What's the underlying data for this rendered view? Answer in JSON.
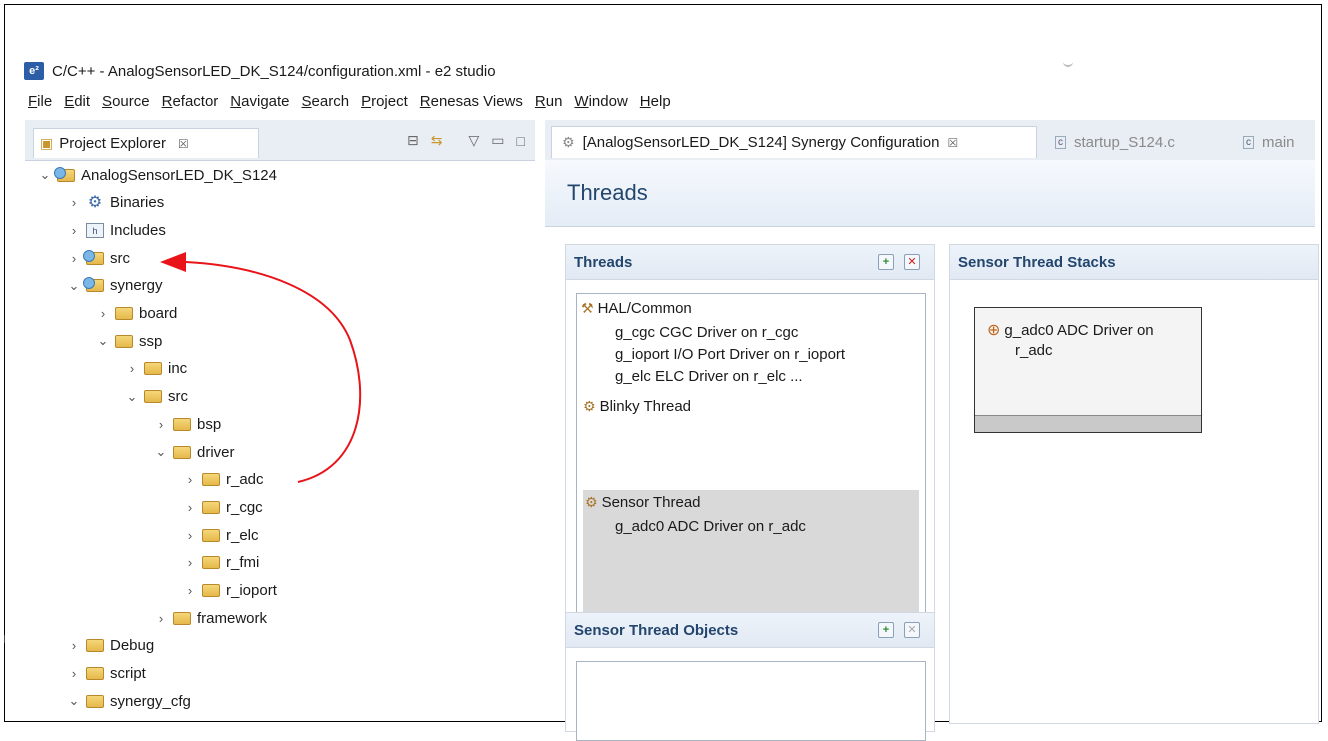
{
  "window": {
    "title": "C/C++ - AnalogSensorLED_DK_S124/configuration.xml - e2 studio",
    "logo_text": "e²"
  },
  "menu": [
    "File",
    "Edit",
    "Source",
    "Refactor",
    "Navigate",
    "Search",
    "Project",
    "Renesas Views",
    "Run",
    "Window",
    "Help"
  ],
  "project_explorer": {
    "tab_label": "Project Explorer",
    "tab_close": "☒",
    "tree": [
      {
        "label": "AnalogSensorLED_DK_S124",
        "chevron": "⌄",
        "icon": "project-icon"
      },
      {
        "label": "Binaries",
        "chevron": "›",
        "icon": "binaries-icon"
      },
      {
        "label": "Includes",
        "chevron": "›",
        "icon": "includes-icon"
      },
      {
        "label": "src",
        "chevron": "›",
        "icon": "source-folder-icon"
      },
      {
        "label": "synergy",
        "chevron": "⌄",
        "icon": "source-folder-icon"
      },
      {
        "label": "board",
        "chevron": "›",
        "icon": "folder-icon"
      },
      {
        "label": "ssp",
        "chevron": "⌄",
        "icon": "folder-icon"
      },
      {
        "label": "inc",
        "chevron": "›",
        "icon": "folder-icon"
      },
      {
        "label": "src",
        "chevron": "⌄",
        "icon": "folder-icon"
      },
      {
        "label": "bsp",
        "chevron": "›",
        "icon": "folder-icon"
      },
      {
        "label": "driver",
        "chevron": "⌄",
        "icon": "folder-icon"
      },
      {
        "label": "r_adc",
        "chevron": "›",
        "icon": "folder-icon"
      },
      {
        "label": "r_cgc",
        "chevron": "›",
        "icon": "folder-icon"
      },
      {
        "label": "r_elc",
        "chevron": "›",
        "icon": "folder-icon"
      },
      {
        "label": "r_fmi",
        "chevron": "›",
        "icon": "folder-icon"
      },
      {
        "label": "r_ioport",
        "chevron": "›",
        "icon": "folder-icon"
      },
      {
        "label": "framework",
        "chevron": "›",
        "icon": "folder-icon"
      },
      {
        "label": "Debug",
        "chevron": "›",
        "icon": "folder-icon"
      },
      {
        "label": "script",
        "chevron": "›",
        "icon": "folder-icon"
      },
      {
        "label": "synergy_cfg",
        "chevron": "⌄",
        "icon": "folder-icon"
      }
    ]
  },
  "editor": {
    "tabs": [
      {
        "label": "[AnalogSensorLED_DK_S124] Synergy Configuration",
        "close": "☒"
      },
      {
        "label": "startup_S124.c"
      },
      {
        "label": "main"
      }
    ],
    "page_title": "Threads",
    "threads_section": {
      "title": "Threads",
      "groups": [
        {
          "name": "HAL/Common",
          "items": [
            "g_cgc CGC Driver on r_cgc",
            "g_ioport I/O Port Driver on r_ioport",
            "g_elc ELC Driver on r_elc ..."
          ]
        },
        {
          "name": "Blinky Thread",
          "items": []
        },
        {
          "name": "Sensor Thread",
          "items": [
            "g_adc0 ADC Driver on r_adc"
          ]
        }
      ]
    },
    "stacks_section": {
      "title": "Sensor Thread Stacks",
      "module_line1": "g_adc0 ADC Driver on",
      "module_line2": "r_adc"
    },
    "objects_section": {
      "title": "Sensor Thread Objects"
    }
  },
  "colors": {
    "accent_title": "#23466e",
    "annotation_arrow": "#e8141a",
    "selection": "#d9d9d9"
  }
}
